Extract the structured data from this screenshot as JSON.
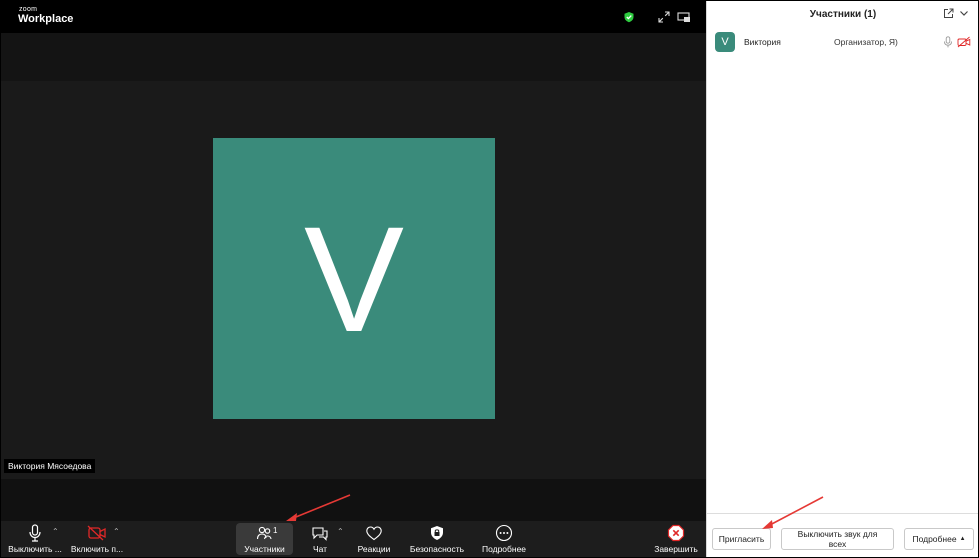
{
  "app": {
    "brand_small": "zoom",
    "brand_big": "Workplace"
  },
  "video": {
    "initial": "V",
    "name_tag": "Виктория Мясоедова"
  },
  "toolbar": {
    "mute_label": "Выключить ...",
    "video_label": "Включить п...",
    "participants_label": "Участники",
    "participants_count": "1",
    "chat_label": "Чат",
    "reactions_label": "Реакции",
    "security_label": "Безопасность",
    "more_label": "Подробнее",
    "end_label": "Завершить"
  },
  "panel": {
    "title": "Участники (1)",
    "participants": [
      {
        "initial": "V",
        "name": "Виктория",
        "role": "Организатор, Я)"
      }
    ],
    "invite_label": "Пригласить",
    "mute_all_label": "Выключить звук для всех",
    "more_label": "Подробнее"
  },
  "colors": {
    "avatar": "#3a8b7b",
    "end_red": "#e02828",
    "shield_green": "#2ecc40",
    "annotation_arrow": "#e53935"
  }
}
